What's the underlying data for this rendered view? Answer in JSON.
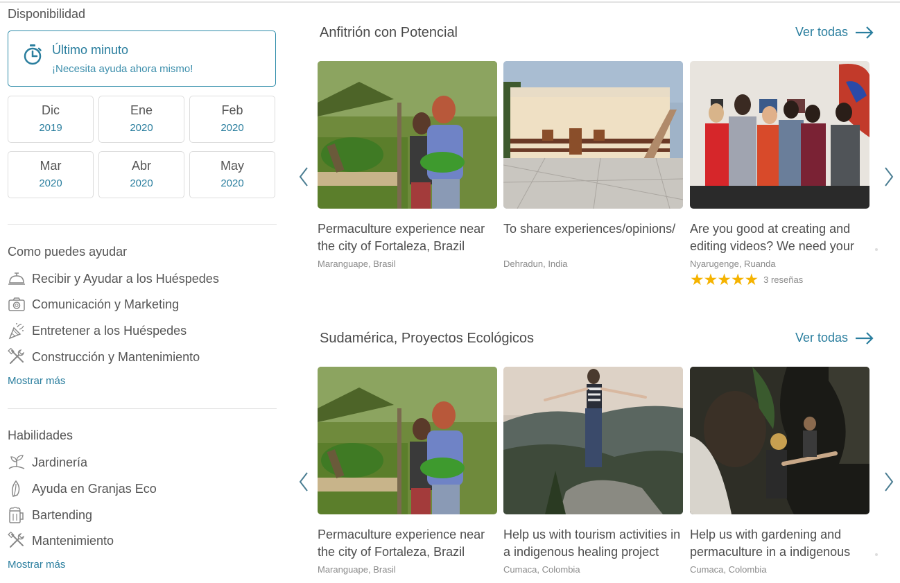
{
  "sidebar": {
    "availability_title": "Disponibilidad",
    "urgent": {
      "title": "Último minuto",
      "subtitle": "¡Necesita ayuda ahora mismo!"
    },
    "months": [
      {
        "month": "Dic",
        "year": "2019"
      },
      {
        "month": "Ene",
        "year": "2020"
      },
      {
        "month": "Feb",
        "year": "2020"
      },
      {
        "month": "Mar",
        "year": "2020"
      },
      {
        "month": "Abr",
        "year": "2020"
      },
      {
        "month": "May",
        "year": "2020"
      }
    ],
    "help_title": "Como puedes ayudar",
    "help_items": [
      {
        "label": "Recibir y Ayudar a los Huéspedes",
        "icon": "reception-bell-icon"
      },
      {
        "label": "Comunicación y Marketing",
        "icon": "camera-icon"
      },
      {
        "label": "Entretener a los Huéspedes",
        "icon": "party-popper-icon"
      },
      {
        "label": "Construcción y Mantenimiento",
        "icon": "tools-icon"
      }
    ],
    "help_more": "Mostrar más",
    "skills_title": "Habilidades",
    "skills_items": [
      {
        "label": "Jardinería",
        "icon": "plant-icon"
      },
      {
        "label": "Ayuda en Granjas Eco",
        "icon": "leaf-icon"
      },
      {
        "label": "Bartending",
        "icon": "beer-mug-icon"
      },
      {
        "label": "Mantenimiento",
        "icon": "tools-icon"
      }
    ],
    "skills_more": "Mostrar más"
  },
  "rows": [
    {
      "title": "Anfitrión con Potencial",
      "see_all": "Ver todas",
      "cards": [
        {
          "title": "Permaculture experience near the city of Fortaleza, Brazil",
          "location": "Maranguape, Brasil"
        },
        {
          "title": "To share experiences/opinions/",
          "location": "Dehradun, India"
        },
        {
          "title": "Are you good at creating and editing videos? We need your",
          "location": "Nyarugenge, Ruanda",
          "stars": "★★★★★",
          "rating_value": 5,
          "reviews": "3 reseñas"
        }
      ]
    },
    {
      "title": "Sudamérica, Proyectos Ecológicos",
      "see_all": "Ver todas",
      "cards": [
        {
          "title": "Permaculture experience near the city of Fortaleza, Brazil",
          "location": "Maranguape, Brasil"
        },
        {
          "title": "Help us with tourism activities in a indigenous healing project",
          "location": "Cumaca, Colombia"
        },
        {
          "title": "Help us with gardening and permaculture in a indigenous",
          "location": "Cumaca, Colombia"
        }
      ]
    }
  ],
  "colors": {
    "accent": "#2a7e9e",
    "star": "#f5b301",
    "border": "#dcdcdc"
  }
}
